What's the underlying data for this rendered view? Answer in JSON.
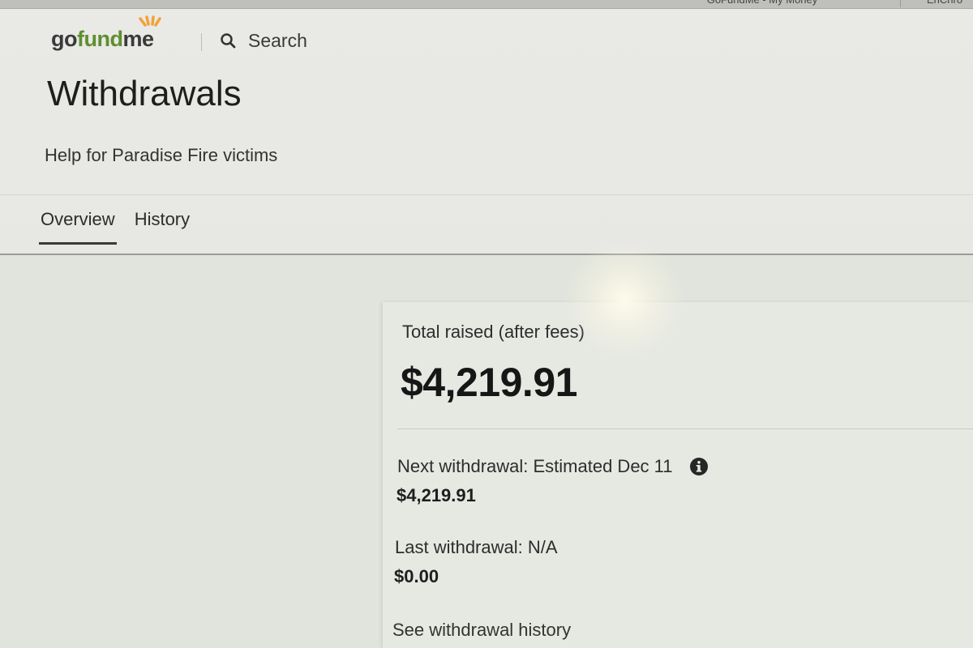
{
  "browser": {
    "tabs": [
      {
        "label": "GoFundMe - My Money"
      },
      {
        "label": "EnChro"
      }
    ]
  },
  "header": {
    "logo": {
      "go": "go",
      "fund": "fund",
      "me": "me"
    },
    "search_label": "Search",
    "page_title": "Withdrawals",
    "campaign_name": "Help for Paradise Fire victims",
    "tabs": [
      {
        "label": "Overview",
        "active": true
      },
      {
        "label": "History",
        "active": false
      }
    ]
  },
  "summary": {
    "total_label": "Total raised (after fees)",
    "total_amount": "$4,219.91",
    "next_withdrawal_label": "Next withdrawal: Estimated Dec 11",
    "next_withdrawal_amount": "$4,219.91",
    "last_withdrawal_label": "Last withdrawal: N/A",
    "last_withdrawal_amount": "$0.00",
    "history_link": "See withdrawal history"
  },
  "colors": {
    "brand_green": "#5e8f2e",
    "logo_burst": "#f2a23a",
    "text": "#2b2b2b"
  },
  "icons": [
    "search-icon",
    "info-icon",
    "logo-burst-icon"
  ]
}
